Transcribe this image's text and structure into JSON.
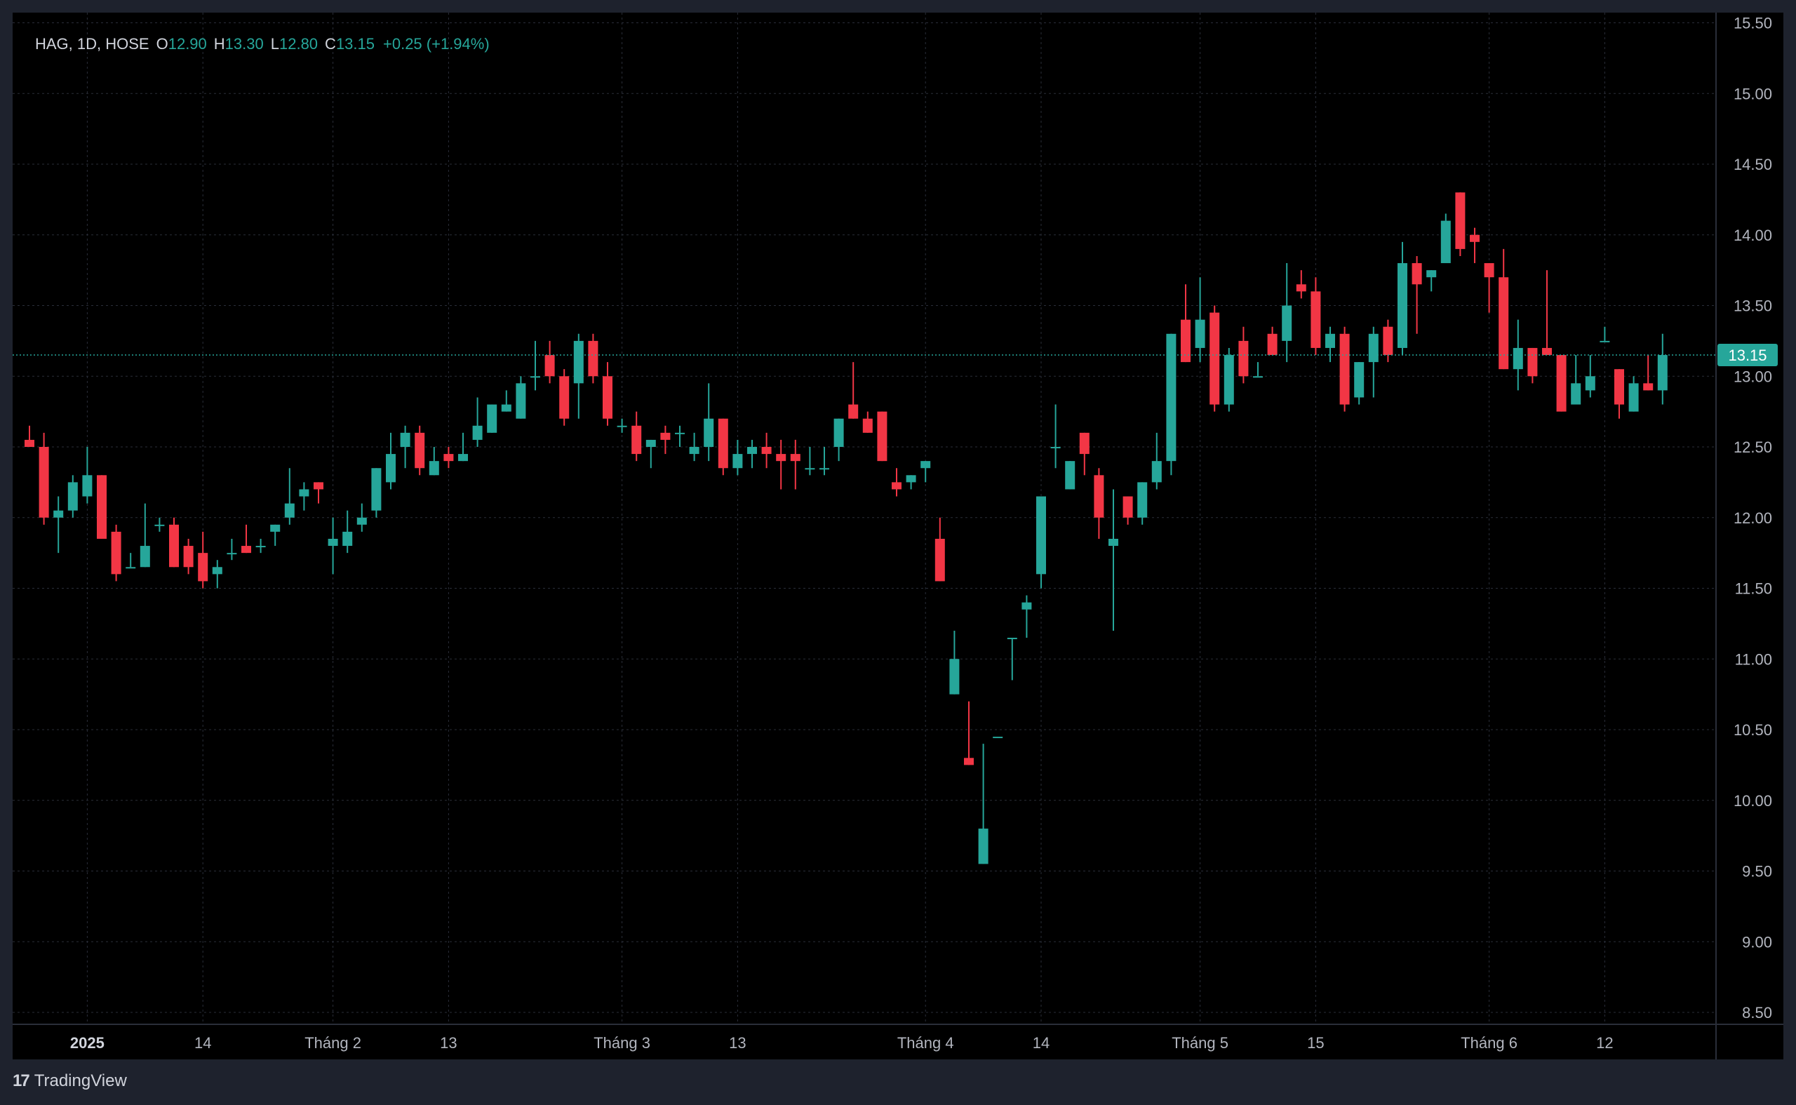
{
  "legend": {
    "symbol": "HAG, 1D, HOSE",
    "o_label": "O",
    "o_value": "12.90",
    "h_label": "H",
    "h_value": "13.30",
    "l_label": "L",
    "l_value": "12.80",
    "c_label": "C",
    "c_value": "13.15",
    "change": "+0.25 (+1.94%)"
  },
  "brand": {
    "logo": "17",
    "name": "TradingView"
  },
  "colors": {
    "up": "#26a69a",
    "down": "#f23645",
    "background": "#000000",
    "grid": "#2a2e39",
    "price_tag": "#26a69a"
  },
  "chart_data": {
    "type": "candlestick",
    "y_ticks": [
      "8.50",
      "9.00",
      "9.50",
      "10.00",
      "10.50",
      "11.00",
      "11.50",
      "12.00",
      "12.50",
      "13.00",
      "13.50",
      "14.00",
      "14.50",
      "15.00",
      "15.50"
    ],
    "ylim": [
      8.45,
      15.55
    ],
    "x_ticks": [
      {
        "label": "2025",
        "index": 4,
        "bold": true
      },
      {
        "label": "14",
        "index": 12
      },
      {
        "label": "Tháng 2",
        "index": 21
      },
      {
        "label": "13",
        "index": 29
      },
      {
        "label": "Tháng 3",
        "index": 41
      },
      {
        "label": "13",
        "index": 49
      },
      {
        "label": "Tháng 4",
        "index": 62
      },
      {
        "label": "14",
        "index": 70
      },
      {
        "label": "Tháng 5",
        "index": 81
      },
      {
        "label": "15",
        "index": 89
      },
      {
        "label": "Tháng 6",
        "index": 101
      },
      {
        "label": "12",
        "index": 109
      }
    ],
    "last_price": "13.15",
    "grid": true,
    "candles": [
      [
        12.55,
        12.65,
        12.5,
        12.5
      ],
      [
        12.5,
        12.6,
        11.95,
        12.0
      ],
      [
        12.0,
        12.15,
        11.75,
        12.05
      ],
      [
        12.05,
        12.3,
        12.0,
        12.25
      ],
      [
        12.15,
        12.5,
        12.1,
        12.3
      ],
      [
        12.3,
        12.3,
        11.85,
        11.85
      ],
      [
        11.9,
        11.95,
        11.55,
        11.6
      ],
      [
        11.65,
        11.75,
        11.65,
        11.65
      ],
      [
        11.65,
        12.1,
        11.65,
        11.8
      ],
      [
        11.95,
        12.0,
        11.9,
        11.95
      ],
      [
        11.95,
        12.0,
        11.65,
        11.65
      ],
      [
        11.8,
        11.85,
        11.6,
        11.65
      ],
      [
        11.75,
        11.9,
        11.5,
        11.55
      ],
      [
        11.6,
        11.7,
        11.5,
        11.65
      ],
      [
        11.75,
        11.85,
        11.7,
        11.75
      ],
      [
        11.8,
        11.95,
        11.75,
        11.75
      ],
      [
        11.8,
        11.85,
        11.75,
        11.8
      ],
      [
        11.9,
        11.95,
        11.8,
        11.95
      ],
      [
        12.0,
        12.35,
        11.95,
        12.1
      ],
      [
        12.15,
        12.25,
        12.05,
        12.2
      ],
      [
        12.25,
        12.25,
        12.1,
        12.2
      ],
      [
        11.8,
        12.0,
        11.6,
        11.85
      ],
      [
        11.8,
        12.05,
        11.75,
        11.9
      ],
      [
        11.95,
        12.1,
        11.9,
        12.0
      ],
      [
        12.05,
        12.35,
        12.0,
        12.35
      ],
      [
        12.25,
        12.6,
        12.2,
        12.45
      ],
      [
        12.5,
        12.65,
        12.35,
        12.6
      ],
      [
        12.6,
        12.65,
        12.3,
        12.35
      ],
      [
        12.3,
        12.5,
        12.3,
        12.4
      ],
      [
        12.45,
        12.5,
        12.35,
        12.4
      ],
      [
        12.4,
        12.6,
        12.4,
        12.45
      ],
      [
        12.55,
        12.85,
        12.5,
        12.65
      ],
      [
        12.6,
        12.8,
        12.6,
        12.8
      ],
      [
        12.75,
        12.9,
        12.75,
        12.8
      ],
      [
        12.7,
        13.0,
        12.7,
        12.95
      ],
      [
        13.0,
        13.25,
        12.9,
        13.0
      ],
      [
        13.15,
        13.25,
        12.95,
        13.0
      ],
      [
        13.0,
        13.05,
        12.65,
        12.7
      ],
      [
        12.95,
        13.3,
        12.7,
        13.25
      ],
      [
        13.25,
        13.3,
        12.95,
        13.0
      ],
      [
        13.0,
        13.1,
        12.65,
        12.7
      ],
      [
        12.65,
        12.7,
        12.6,
        12.65
      ],
      [
        12.65,
        12.75,
        12.4,
        12.45
      ],
      [
        12.5,
        12.55,
        12.35,
        12.55
      ],
      [
        12.6,
        12.65,
        12.45,
        12.55
      ],
      [
        12.6,
        12.65,
        12.5,
        12.6
      ],
      [
        12.45,
        12.6,
        12.4,
        12.5
      ],
      [
        12.5,
        12.95,
        12.4,
        12.7
      ],
      [
        12.7,
        12.7,
        12.3,
        12.35
      ],
      [
        12.35,
        12.55,
        12.3,
        12.45
      ],
      [
        12.45,
        12.55,
        12.35,
        12.5
      ],
      [
        12.5,
        12.6,
        12.35,
        12.45
      ],
      [
        12.45,
        12.55,
        12.2,
        12.4
      ],
      [
        12.45,
        12.55,
        12.2,
        12.4
      ],
      [
        12.35,
        12.5,
        12.3,
        12.35
      ],
      [
        12.35,
        12.5,
        12.3,
        12.35
      ],
      [
        12.5,
        12.7,
        12.4,
        12.7
      ],
      [
        12.8,
        13.1,
        12.7,
        12.7
      ],
      [
        12.7,
        12.75,
        12.6,
        12.6
      ],
      [
        12.75,
        12.75,
        12.4,
        12.4
      ],
      [
        12.25,
        12.35,
        12.15,
        12.2
      ],
      [
        12.25,
        12.3,
        12.2,
        12.3
      ],
      [
        12.35,
        12.4,
        12.25,
        12.4
      ],
      [
        11.85,
        12.0,
        11.55,
        11.55
      ],
      [
        10.75,
        11.2,
        10.75,
        11.0
      ],
      [
        10.3,
        10.7,
        10.25,
        10.25
      ],
      [
        9.55,
        10.4,
        9.55,
        9.8
      ],
      [
        10.45,
        10.45,
        10.45,
        10.45
      ],
      [
        11.15,
        11.15,
        10.85,
        11.15
      ],
      [
        11.35,
        11.45,
        11.15,
        11.4
      ],
      [
        11.6,
        12.15,
        11.5,
        12.15
      ],
      [
        12.5,
        12.8,
        12.35,
        12.5
      ],
      [
        12.2,
        12.4,
        12.2,
        12.4
      ],
      [
        12.6,
        12.6,
        12.3,
        12.45
      ],
      [
        12.3,
        12.35,
        11.85,
        12.0
      ],
      [
        11.8,
        12.2,
        11.2,
        11.85
      ],
      [
        12.15,
        12.15,
        11.95,
        12.0
      ],
      [
        12.0,
        12.25,
        11.95,
        12.25
      ],
      [
        12.25,
        12.6,
        12.2,
        12.4
      ],
      [
        12.4,
        13.3,
        12.3,
        13.3
      ],
      [
        13.4,
        13.65,
        13.1,
        13.1
      ],
      [
        13.2,
        13.7,
        13.1,
        13.4
      ],
      [
        13.45,
        13.5,
        12.75,
        12.8
      ],
      [
        12.8,
        13.2,
        12.75,
        13.15
      ],
      [
        13.25,
        13.35,
        12.95,
        13.0
      ],
      [
        13.0,
        13.1,
        13.0,
        13.0
      ],
      [
        13.3,
        13.35,
        13.15,
        13.15
      ],
      [
        13.25,
        13.8,
        13.1,
        13.5
      ],
      [
        13.65,
        13.75,
        13.55,
        13.6
      ],
      [
        13.6,
        13.7,
        13.15,
        13.2
      ],
      [
        13.2,
        13.35,
        13.1,
        13.3
      ],
      [
        13.3,
        13.35,
        12.75,
        12.8
      ],
      [
        12.85,
        13.1,
        12.8,
        13.1
      ],
      [
        13.1,
        13.35,
        12.85,
        13.3
      ],
      [
        13.35,
        13.4,
        13.1,
        13.15
      ],
      [
        13.2,
        13.95,
        13.15,
        13.8
      ],
      [
        13.8,
        13.85,
        13.3,
        13.65
      ],
      [
        13.7,
        13.75,
        13.6,
        13.75
      ],
      [
        13.8,
        14.15,
        13.8,
        14.1
      ],
      [
        14.3,
        14.3,
        13.85,
        13.9
      ],
      [
        14.0,
        14.05,
        13.8,
        13.95
      ],
      [
        13.8,
        13.8,
        13.45,
        13.7
      ],
      [
        13.7,
        13.9,
        13.05,
        13.05
      ],
      [
        13.05,
        13.4,
        12.9,
        13.2
      ],
      [
        13.2,
        13.2,
        12.95,
        13.0
      ],
      [
        13.2,
        13.75,
        13.15,
        13.15
      ],
      [
        13.15,
        13.15,
        12.75,
        12.75
      ],
      [
        12.8,
        13.15,
        12.8,
        12.95
      ],
      [
        12.9,
        13.15,
        12.85,
        13.0
      ],
      [
        13.25,
        13.35,
        13.25,
        13.25
      ],
      [
        13.05,
        13.05,
        12.7,
        12.8
      ],
      [
        12.75,
        13.0,
        12.75,
        12.95
      ],
      [
        12.95,
        13.15,
        12.9,
        12.9
      ],
      [
        12.9,
        13.3,
        12.8,
        13.15
      ]
    ]
  }
}
